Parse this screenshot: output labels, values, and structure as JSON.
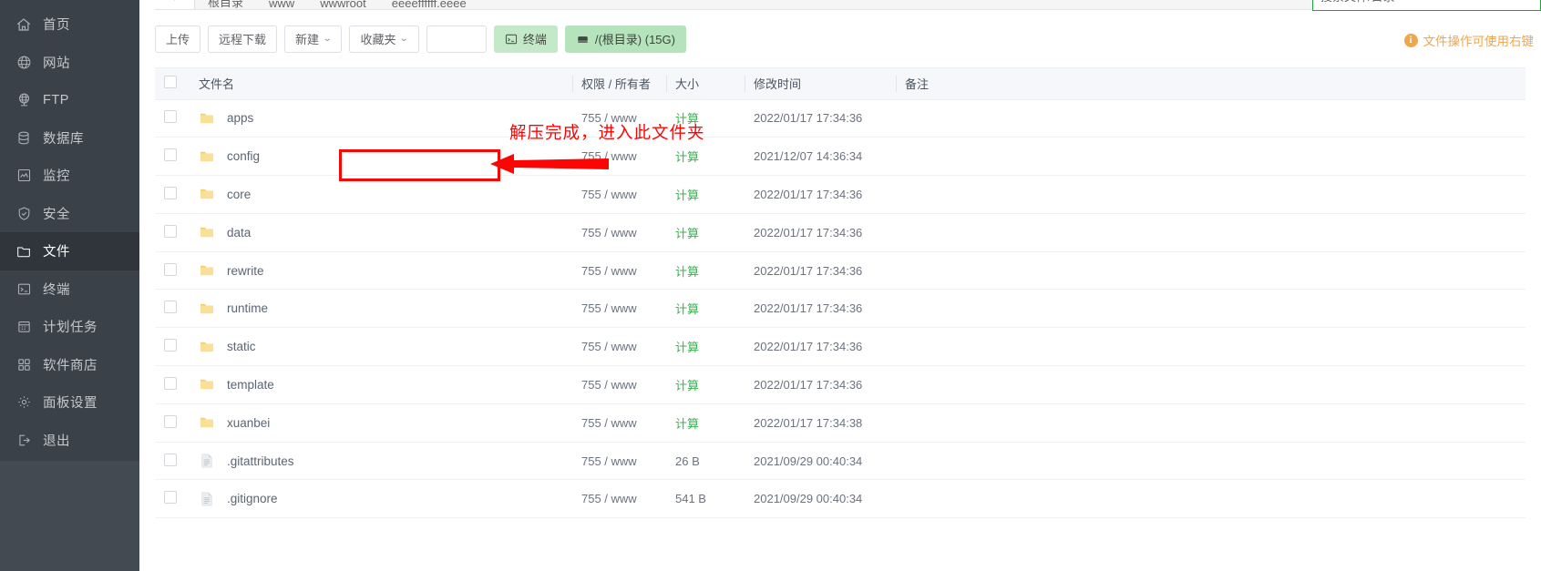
{
  "sidebar": {
    "items": [
      {
        "label": "首页",
        "icon": "home-icon",
        "active": false
      },
      {
        "label": "网站",
        "icon": "globe-icon",
        "active": false
      },
      {
        "label": "FTP",
        "icon": "ftp-icon",
        "active": false
      },
      {
        "label": "数据库",
        "icon": "database-icon",
        "active": false
      },
      {
        "label": "监控",
        "icon": "monitor-icon",
        "active": false
      },
      {
        "label": "安全",
        "icon": "shield-icon",
        "active": false
      },
      {
        "label": "文件",
        "icon": "folder-icon",
        "active": true
      },
      {
        "label": "终端",
        "icon": "terminal-icon",
        "active": false
      },
      {
        "label": "计划任务",
        "icon": "calendar-icon",
        "active": false
      },
      {
        "label": "软件商店",
        "icon": "apps-grid-icon",
        "active": false
      },
      {
        "label": "面板设置",
        "icon": "gear-icon",
        "active": false
      },
      {
        "label": "退出",
        "icon": "logout-icon",
        "active": false
      }
    ]
  },
  "breadcrumb": {
    "up_label": "↑",
    "items": [
      "根目录",
      "www",
      "wwwroot",
      "eeeeffffff.eeee"
    ],
    "refresh_icon": "refresh-icon"
  },
  "top_right_field": {
    "value": "搜索文件/目录"
  },
  "toolbar": {
    "upload_label": "上传",
    "remote_download_label": "远程下载",
    "new_label": "新建",
    "favorites_label": "收藏夹",
    "search_value": "",
    "search_placeholder": "",
    "terminal_label": "终端",
    "terminal_icon": "terminal-icon",
    "disk_icon": "disk-icon",
    "disk_label": "/(根目录) (15G)",
    "notice_icon": "info-icon",
    "notice_text": "文件操作可使用右键"
  },
  "table": {
    "headers": {
      "checkbox": "",
      "name": "文件名",
      "permission": "权限 / 所有者",
      "size": "大小",
      "mtime": "修改时间",
      "note": "备注"
    },
    "rows": [
      {
        "icon": "folder-icon",
        "name": "apps",
        "perm": "755 / www",
        "size": "计算",
        "size_link": true,
        "mtime": "2022/01/17 17:34:36",
        "note": ""
      },
      {
        "icon": "folder-icon",
        "name": "config",
        "perm": "755 / www",
        "size": "计算",
        "size_link": true,
        "mtime": "2021/12/07 14:36:34",
        "note": ""
      },
      {
        "icon": "folder-icon",
        "name": "core",
        "perm": "755 / www",
        "size": "计算",
        "size_link": true,
        "mtime": "2022/01/17 17:34:36",
        "note": ""
      },
      {
        "icon": "folder-icon",
        "name": "data",
        "perm": "755 / www",
        "size": "计算",
        "size_link": true,
        "mtime": "2022/01/17 17:34:36",
        "note": ""
      },
      {
        "icon": "folder-icon",
        "name": "rewrite",
        "perm": "755 / www",
        "size": "计算",
        "size_link": true,
        "mtime": "2022/01/17 17:34:36",
        "note": ""
      },
      {
        "icon": "folder-icon",
        "name": "runtime",
        "perm": "755 / www",
        "size": "计算",
        "size_link": true,
        "mtime": "2022/01/17 17:34:36",
        "note": ""
      },
      {
        "icon": "folder-icon",
        "name": "static",
        "perm": "755 / www",
        "size": "计算",
        "size_link": true,
        "mtime": "2022/01/17 17:34:36",
        "note": ""
      },
      {
        "icon": "folder-icon",
        "name": "template",
        "perm": "755 / www",
        "size": "计算",
        "size_link": true,
        "mtime": "2022/01/17 17:34:36",
        "note": ""
      },
      {
        "icon": "folder-icon",
        "name": "xuanbei",
        "perm": "755 / www",
        "size": "计算",
        "size_link": true,
        "mtime": "2022/01/17 17:34:38",
        "note": ""
      },
      {
        "icon": "file-icon",
        "name": ".gitattributes",
        "perm": "755 / www",
        "size": "26 B",
        "size_link": false,
        "mtime": "2021/09/29 00:40:34",
        "note": ""
      },
      {
        "icon": "file-icon",
        "name": ".gitignore",
        "perm": "755 / www",
        "size": "541 B",
        "size_link": false,
        "mtime": "2021/09/29 00:40:34",
        "note": ""
      }
    ]
  },
  "annotations": {
    "callout_text": "解压完成，进入此文件夹",
    "highlight_target": "config",
    "color": "#fb0505"
  },
  "colors": {
    "sidebar_bg": "#3a4149",
    "sidebar_active": "#2f353b",
    "accent_green": "#3eaf53",
    "button_green": "#c4e9c9",
    "notice_orange": "#f0a64a",
    "annotation_red": "#fb0505"
  }
}
